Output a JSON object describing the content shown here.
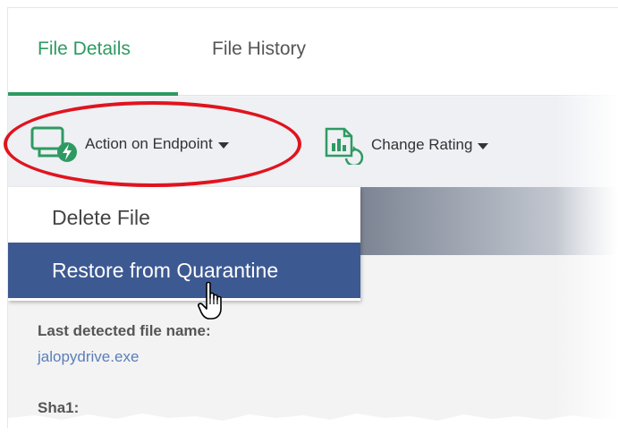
{
  "tabs": [
    {
      "label": "File Details",
      "active": true
    },
    {
      "label": "File History",
      "active": false
    }
  ],
  "toolbar": {
    "action_label": "Action on Endpoint",
    "rating_label": "Change Rating"
  },
  "dropdown": {
    "items": [
      {
        "label": "Delete File",
        "selected": false
      },
      {
        "label": "Restore from Quarantine",
        "selected": true
      }
    ]
  },
  "details": {
    "last_detected_label": "Last detected file name:",
    "last_detected_value": "jalopydrive.exe",
    "sha1_label": "Sha1:"
  },
  "colors": {
    "accent_green": "#2e9a62",
    "selected_item": "#3d5992",
    "highlight_red": "#e0141e",
    "link_blue": "#5b7eb8"
  },
  "icons": [
    "endpoint-action-icon",
    "change-rating-icon",
    "caret-down-icon",
    "hand-pointer-icon"
  ]
}
